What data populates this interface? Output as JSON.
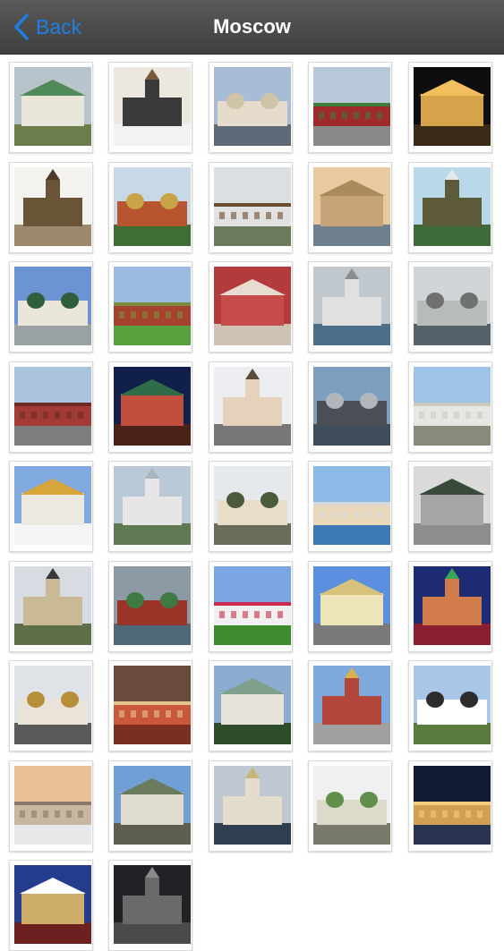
{
  "nav": {
    "back_label": "Back",
    "title": "Moscow"
  },
  "colors": {
    "accent": "#1e7fe8",
    "navbar": "#4a4a4a"
  },
  "photos": [
    {
      "sky": "#b8c4cc",
      "ground": "#6b7d4a",
      "bldg": "#e8e6d8",
      "roof": "#4f8a58"
    },
    {
      "sky": "#ece8e0",
      "ground": "#f2f2f2",
      "bldg": "#3a3a3a",
      "roof": "#7a5a3a"
    },
    {
      "sky": "#a7bdd7",
      "ground": "#5f6a78",
      "bldg": "#e5dccb",
      "roof": "#cfc3a8"
    },
    {
      "sky": "#b7c8d9",
      "ground": "#8a8a8a",
      "bldg": "#9e2a2a",
      "roof": "#3f7a3f"
    },
    {
      "sky": "#0e0e0e",
      "ground": "#3b2a15",
      "bldg": "#d6a24a",
      "roof": "#f0c060"
    },
    {
      "sky": "#f4f2ee",
      "ground": "#9b8a70",
      "bldg": "#6a5438",
      "roof": "#4b3a2a"
    },
    {
      "sky": "#c9d8e6",
      "ground": "#3e6e34",
      "bldg": "#b8542f",
      "roof": "#c9a347"
    },
    {
      "sky": "#dcdfe2",
      "ground": "#6a7a5a",
      "bldg": "#e1e1e1",
      "roof": "#6d4f2f"
    },
    {
      "sky": "#e9c9a0",
      "ground": "#6e7f8e",
      "bldg": "#c7a478",
      "roof": "#a98a5a"
    },
    {
      "sky": "#b9d9ea",
      "ground": "#3f6b3a",
      "bldg": "#5d5a3a",
      "roof": "#e2e8ec"
    },
    {
      "sky": "#6c93d3",
      "ground": "#98a2a4",
      "bldg": "#ebe6da",
      "roof": "#2f5f3a"
    },
    {
      "sky": "#9bbbe1",
      "ground": "#58a03e",
      "bldg": "#a7412f",
      "roof": "#7e8a3e"
    },
    {
      "sky": "#b33b3b",
      "ground": "#cfc1b4",
      "bldg": "#c64c4c",
      "roof": "#e8dcd0"
    },
    {
      "sky": "#c0c8cd",
      "ground": "#4b6f8a",
      "bldg": "#e0e0e0",
      "roof": "#8d8d8d"
    },
    {
      "sky": "#d2d5d8",
      "ground": "#56616a",
      "bldg": "#b8bcb8",
      "roof": "#6e716e"
    },
    {
      "sky": "#aac4de",
      "ground": "#7d7d7d",
      "bldg": "#a33a36",
      "roof": "#6f2a25"
    },
    {
      "sky": "#10204a",
      "ground": "#4a2218",
      "bldg": "#c24e3e",
      "roof": "#2f6d4a"
    },
    {
      "sky": "#ebedf0",
      "ground": "#777777",
      "bldg": "#e6d2ba",
      "roof": "#5a4a3a"
    },
    {
      "sky": "#7d9fbf",
      "ground": "#3f4c5a",
      "bldg": "#4a4f55",
      "roof": "#b0b6bc"
    },
    {
      "sky": "#9fc3e7",
      "ground": "#8a8a7a",
      "bldg": "#e8e6e0",
      "roof": "#c9c9c2"
    },
    {
      "sky": "#7fa9df",
      "ground": "#f4f4f4",
      "bldg": "#ece8e2",
      "roof": "#d7a53a"
    },
    {
      "sky": "#b9c9d7",
      "ground": "#5f7a52",
      "bldg": "#e6e6e6",
      "roof": "#a9b4bc"
    },
    {
      "sky": "#e5e8ec",
      "ground": "#6b6b5a",
      "bldg": "#e7ddc9",
      "roof": "#4a5a3a"
    },
    {
      "sky": "#8db9e6",
      "ground": "#3c79b6",
      "bldg": "#e8d7b8",
      "roof": "#d9d9d9"
    },
    {
      "sky": "#dadada",
      "ground": "#8e8e8e",
      "bldg": "#a6a6a6",
      "roof": "#3a4a3a"
    },
    {
      "sky": "#d6dce2",
      "ground": "#5f6f4a",
      "bldg": "#c9b994",
      "roof": "#3a3a3a"
    },
    {
      "sky": "#8c9aa6",
      "ground": "#4e6a7a",
      "bldg": "#9a3328",
      "roof": "#3f7a45"
    },
    {
      "sky": "#7aa6e6",
      "ground": "#3e8a2f",
      "bldg": "#f0f0f0",
      "roof": "#cc2a4a"
    },
    {
      "sky": "#5d8fe0",
      "ground": "#7a7a7a",
      "bldg": "#ede5b8",
      "roof": "#d6c27a"
    },
    {
      "sky": "#1d2b73",
      "ground": "#8a1f2f",
      "bldg": "#d27b4a",
      "roof": "#3aa65a"
    },
    {
      "sky": "#dfe3e8",
      "ground": "#5a5a5a",
      "bldg": "#e9e3da",
      "roof": "#b78e3a"
    },
    {
      "sky": "#6a4a3a",
      "ground": "#7a2f20",
      "bldg": "#c8573b",
      "roof": "#e7c38a"
    },
    {
      "sky": "#8cabd1",
      "ground": "#2f4d2a",
      "bldg": "#e7e3da",
      "roof": "#7fa08a"
    },
    {
      "sky": "#7ea9dd",
      "ground": "#a0a0a0",
      "bldg": "#b3463a",
      "roof": "#d8b24a"
    },
    {
      "sky": "#a9c6e8",
      "ground": "#5a7a3f",
      "bldg": "#ffffff",
      "roof": "#2c2c2c"
    },
    {
      "sky": "#e8c296",
      "ground": "#e6e8ea",
      "bldg": "#c8b7a0",
      "roof": "#8a7a6a"
    },
    {
      "sky": "#6f9fd4",
      "ground": "#5f5f4f",
      "bldg": "#e0dbcf",
      "roof": "#6a7a5a"
    },
    {
      "sky": "#bfc7d0",
      "ground": "#2f3f4f",
      "bldg": "#e4dccd",
      "roof": "#c9b47a"
    },
    {
      "sky": "#f0f0f0",
      "ground": "#7a7a6a",
      "bldg": "#dcdac8",
      "roof": "#5f8f4a"
    },
    {
      "sky": "#121a36",
      "ground": "#2a3452",
      "bldg": "#d2a050",
      "roof": "#f1cf7a"
    },
    {
      "sky": "#253d8c",
      "ground": "#6d2020",
      "bldg": "#cfae6a",
      "roof": "#ffffff"
    },
    {
      "sky": "#202225",
      "ground": "#4a4a4a",
      "bldg": "#6a6a6a",
      "roof": "#8a8a8a"
    }
  ]
}
